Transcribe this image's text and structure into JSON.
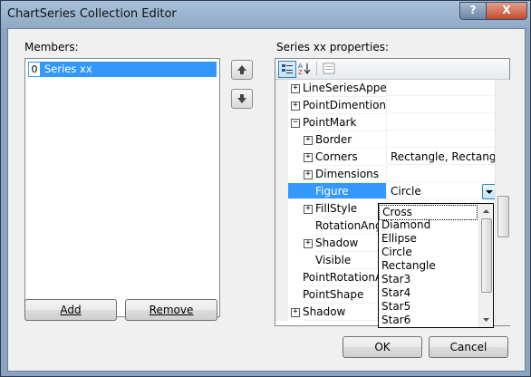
{
  "window": {
    "title": "ChartSeries Collection Editor",
    "help_label": "?",
    "close_label": "X"
  },
  "members": {
    "label": "Members:",
    "items": [
      {
        "index": "0",
        "name": "Series xx"
      }
    ],
    "add_label": "Add",
    "remove_label": "Remove"
  },
  "properties": {
    "label": "Series xx properties:",
    "rows": [
      {
        "name": "LineSeriesAppear",
        "value": "",
        "expander": "+",
        "level": 0
      },
      {
        "name": "PointDimentions",
        "value": "",
        "expander": "+",
        "level": 0
      },
      {
        "name": "PointMark",
        "value": "",
        "expander": "−",
        "level": 0
      },
      {
        "name": "Border",
        "value": "",
        "expander": "+",
        "level": 1
      },
      {
        "name": "Corners",
        "value": "Rectangle, Rectangle, R",
        "expander": "+",
        "level": 1
      },
      {
        "name": "Dimensions",
        "value": "",
        "expander": "+",
        "level": 1
      },
      {
        "name": "Figure",
        "value": "Circle",
        "expander": "",
        "level": 1
      },
      {
        "name": "FillStyle",
        "value": "",
        "expander": "+",
        "level": 1
      },
      {
        "name": "RotationAngle",
        "value": "",
        "expander": "",
        "level": 1
      },
      {
        "name": "Shadow",
        "value": "",
        "expander": "+",
        "level": 1
      },
      {
        "name": "Visible",
        "value": "",
        "expander": "",
        "level": 1
      },
      {
        "name": "PointRotationAn",
        "value": "",
        "expander": "",
        "level": 0
      },
      {
        "name": "PointShape",
        "value": "",
        "expander": "",
        "level": 0
      },
      {
        "name": "Shadow",
        "value": "",
        "expander": "+",
        "level": 0
      }
    ]
  },
  "figure_dropdown": {
    "options": [
      "Cross",
      "Diamond",
      "Ellipse",
      "Circle",
      "Rectangle",
      "Star3",
      "Star4",
      "Star5",
      "Star6"
    ]
  },
  "buttons": {
    "ok": "OK",
    "cancel": "Cancel"
  },
  "colors": {
    "selection": "#3399ff",
    "title_gradient_top": "#a9c1db",
    "close_button": "#c54a2f"
  }
}
